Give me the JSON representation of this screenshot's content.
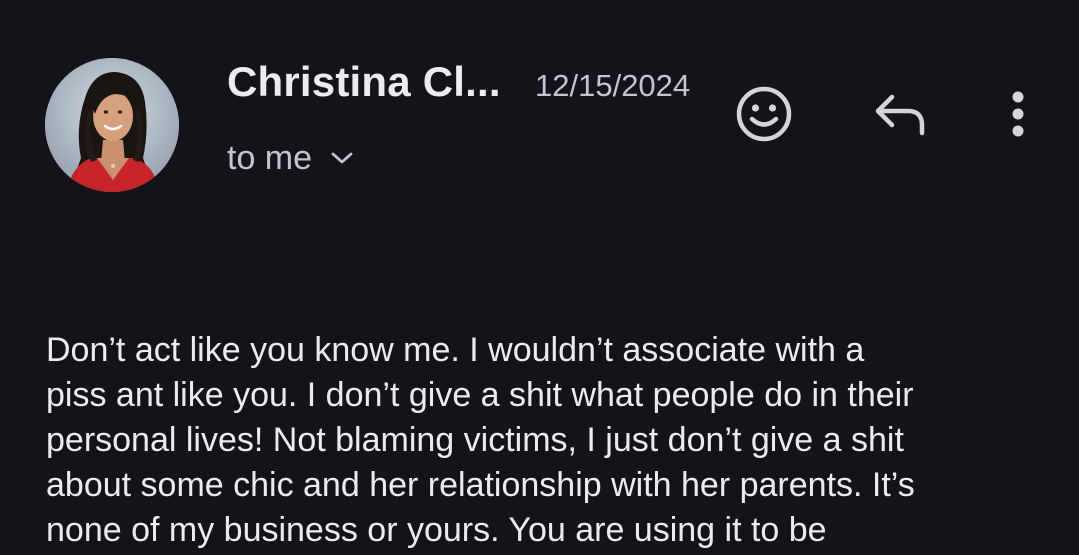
{
  "email": {
    "sender_name": "Christina Cl...",
    "date": "12/15/2024",
    "recipient_label": "to me",
    "body": "Don’t act like you know me. I wouldn’t associate with a\npiss ant like you. I don’t give a shit what people do in their\npersonal lives! Not blaming victims, I just don’t give a shit\nabout some chic and her relationship with her parents. It’s\nnone of my business or yours. You are using it to be"
  },
  "icons": {
    "avatar": "sender-avatar",
    "expand": "chevron-down-icon",
    "emoji": "smiley-face-icon",
    "reply": "reply-arrow-icon",
    "more": "more-vertical-icon"
  },
  "colors": {
    "background": "#131319",
    "primary_text": "#ececf0",
    "secondary_text": "#c4c4cc",
    "icon": "#d4d4da"
  }
}
